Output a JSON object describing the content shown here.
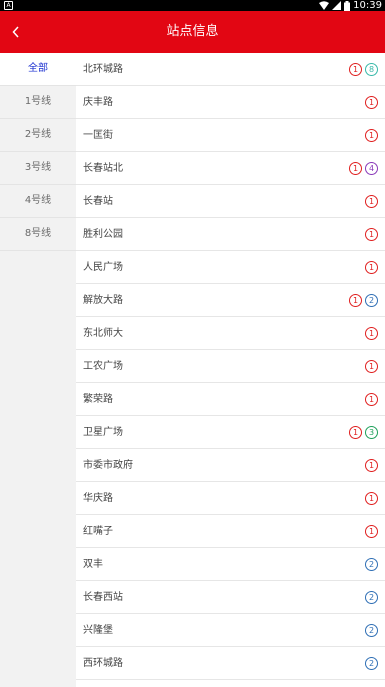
{
  "status": {
    "time": "10:39",
    "left_icon": "A"
  },
  "header": {
    "title": "站点信息",
    "back_icon": "chevron-left-icon"
  },
  "line_colors": {
    "1": "#e02020",
    "2": "#2f6fb5",
    "3": "#1fa05a",
    "4": "#8a3ab9",
    "8": "#39b9a9"
  },
  "sidebar": {
    "items": [
      {
        "label": "全部",
        "active": true
      },
      {
        "label": "1号线",
        "active": false
      },
      {
        "label": "2号线",
        "active": false
      },
      {
        "label": "3号线",
        "active": false
      },
      {
        "label": "4号线",
        "active": false
      },
      {
        "label": "8号线",
        "active": false
      }
    ]
  },
  "stations": [
    {
      "name": "北环城路",
      "lines": [
        "1",
        "8"
      ]
    },
    {
      "name": "庆丰路",
      "lines": [
        "1"
      ]
    },
    {
      "name": "一匡街",
      "lines": [
        "1"
      ]
    },
    {
      "name": "长春站北",
      "lines": [
        "1",
        "4"
      ]
    },
    {
      "name": "长春站",
      "lines": [
        "1"
      ]
    },
    {
      "name": "胜利公园",
      "lines": [
        "1"
      ]
    },
    {
      "name": "人民广场",
      "lines": [
        "1"
      ]
    },
    {
      "name": "解放大路",
      "lines": [
        "1",
        "2"
      ]
    },
    {
      "name": "东北师大",
      "lines": [
        "1"
      ]
    },
    {
      "name": "工农广场",
      "lines": [
        "1"
      ]
    },
    {
      "name": "繁荣路",
      "lines": [
        "1"
      ]
    },
    {
      "name": "卫星广场",
      "lines": [
        "1",
        "3"
      ]
    },
    {
      "name": "市委市政府",
      "lines": [
        "1"
      ]
    },
    {
      "name": "华庆路",
      "lines": [
        "1"
      ]
    },
    {
      "name": "红嘴子",
      "lines": [
        "1"
      ]
    },
    {
      "name": "双丰",
      "lines": [
        "2"
      ]
    },
    {
      "name": "长春西站",
      "lines": [
        "2"
      ]
    },
    {
      "name": "兴隆堡",
      "lines": [
        "2"
      ]
    },
    {
      "name": "西环城路",
      "lines": [
        "2"
      ]
    }
  ]
}
